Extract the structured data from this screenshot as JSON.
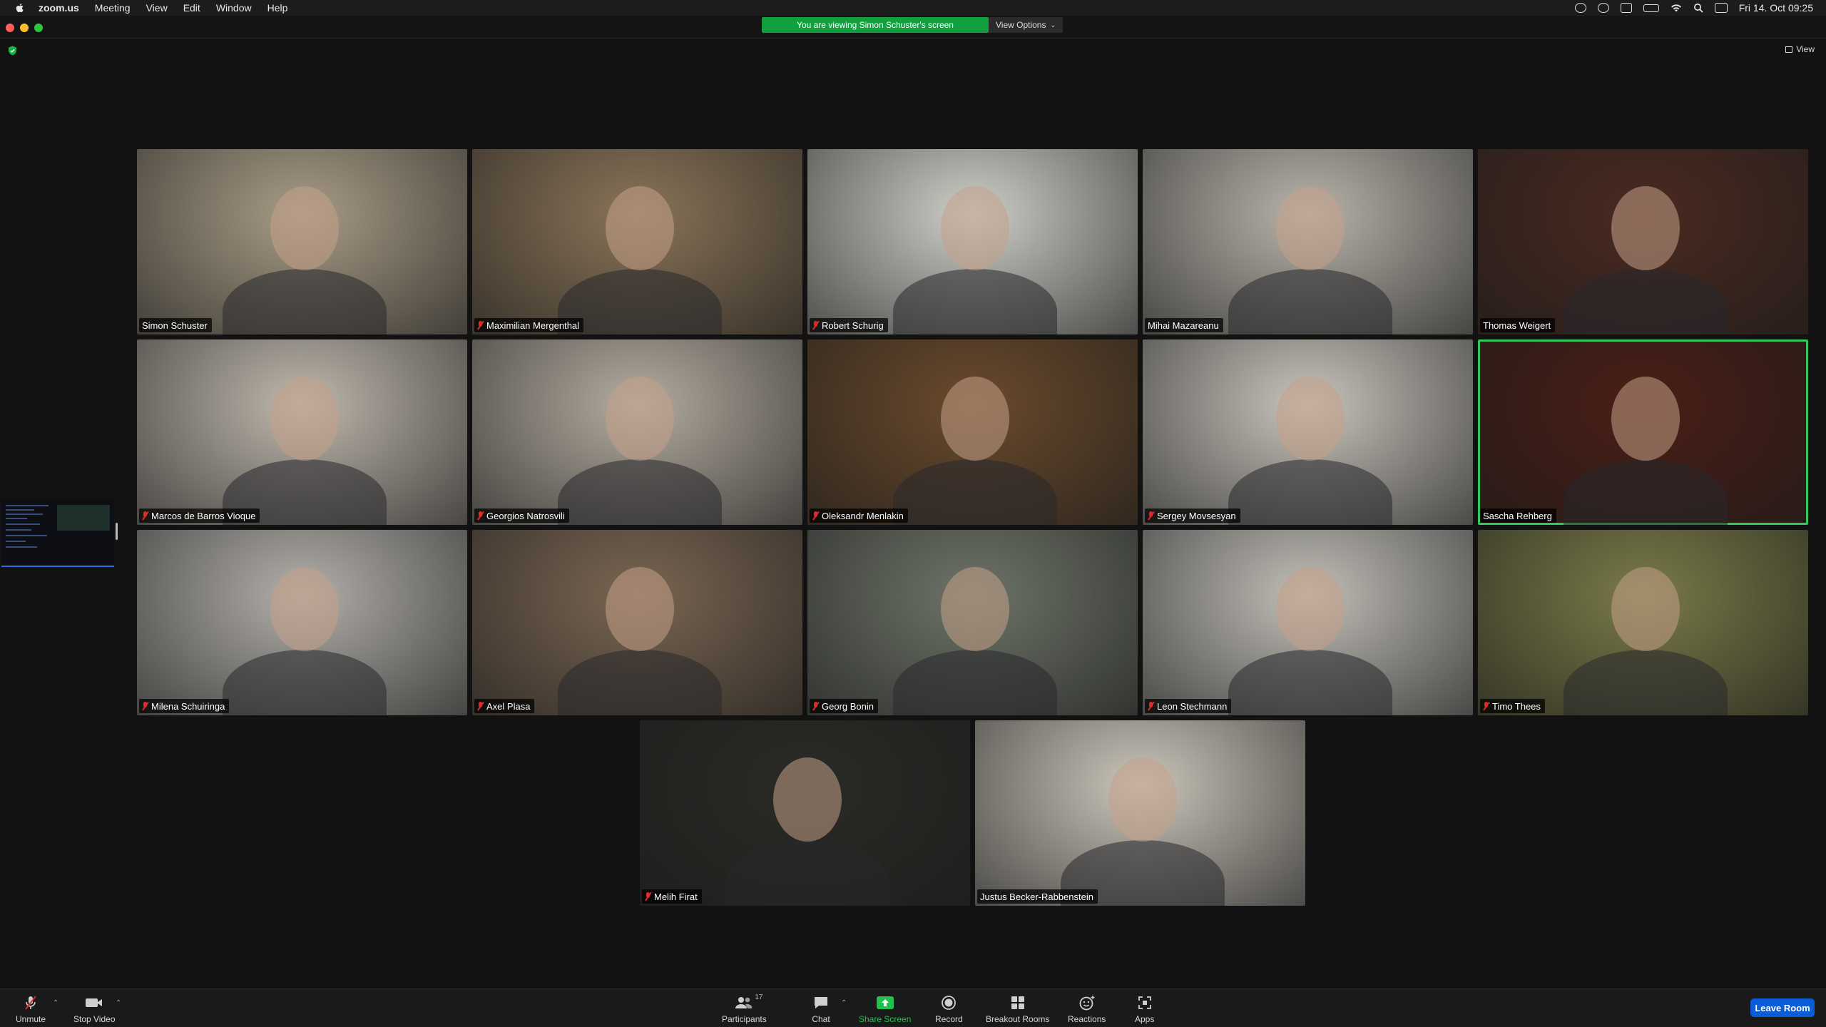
{
  "menubar": {
    "app_name": "zoom.us",
    "menus": [
      "Meeting",
      "View",
      "Edit",
      "Window",
      "Help"
    ],
    "clock": "Fri 14. Oct  09:25"
  },
  "banner": {
    "viewing_text": "You are viewing Simon Schuster's screen",
    "view_options_label": "View Options"
  },
  "view_button_label": "View",
  "participants": [
    {
      "name": "Simon Schuster",
      "muted": false,
      "active_speaker": false,
      "bg": "#a89c86"
    },
    {
      "name": "Maximilian Mergenthal",
      "muted": true,
      "active_speaker": false,
      "bg": "#8a7458"
    },
    {
      "name": "Robert Schurig",
      "muted": true,
      "active_speaker": false,
      "bg": "#cfcfc8"
    },
    {
      "name": "Mihai Mazareanu",
      "muted": false,
      "active_speaker": false,
      "bg": "#b8b4ab"
    },
    {
      "name": "Thomas Weigert",
      "muted": false,
      "active_speaker": false,
      "bg": "#4a2a20"
    },
    {
      "name": "Marcos de Barros Vioque",
      "muted": true,
      "active_speaker": false,
      "bg": "#bfb8ad"
    },
    {
      "name": "Georgios Natrosvili",
      "muted": true,
      "active_speaker": false,
      "bg": "#b4aca0"
    },
    {
      "name": "Oleksandr Menlakin",
      "muted": true,
      "active_speaker": false,
      "bg": "#6a4a2c"
    },
    {
      "name": "Sergey Movsesyan",
      "muted": true,
      "active_speaker": false,
      "bg": "#c8c4bc"
    },
    {
      "name": "Sascha Rehberg",
      "muted": false,
      "active_speaker": true,
      "bg": "#4a1e16"
    },
    {
      "name": "Milena Schuiringa",
      "muted": true,
      "active_speaker": false,
      "bg": "#b3b0aa"
    },
    {
      "name": "Axel Plasa",
      "muted": true,
      "active_speaker": false,
      "bg": "#7a6652"
    },
    {
      "name": "Georg Bonin",
      "muted": true,
      "active_speaker": false,
      "bg": "#6e7468"
    },
    {
      "name": "Leon Stechmann",
      "muted": true,
      "active_speaker": false,
      "bg": "#c2bfb8"
    },
    {
      "name": "Timo Thees",
      "muted": true,
      "active_speaker": false,
      "bg": "#7a7a48"
    },
    {
      "name": "Melih Firat",
      "muted": true,
      "active_speaker": false,
      "bg": "#2a2a26"
    },
    {
      "name": "Justus Becker-Rabbenstein",
      "muted": false,
      "active_speaker": false,
      "bg": "#cbc6bb"
    }
  ],
  "toolbar": {
    "unmute": "Unmute",
    "stop_video": "Stop Video",
    "participants": "Participants",
    "participants_count": "17",
    "chat": "Chat",
    "share_screen": "Share Screen",
    "record": "Record",
    "breakout_rooms": "Breakout Rooms",
    "reactions": "Reactions",
    "apps": "Apps",
    "leave_room": "Leave Room"
  },
  "colors": {
    "share_green": "#21c14d",
    "banner_green": "#12a03e",
    "leave_blue": "#0b5cd7",
    "active_speaker_border": "#34c759",
    "muted_red": "#e02a2a"
  }
}
